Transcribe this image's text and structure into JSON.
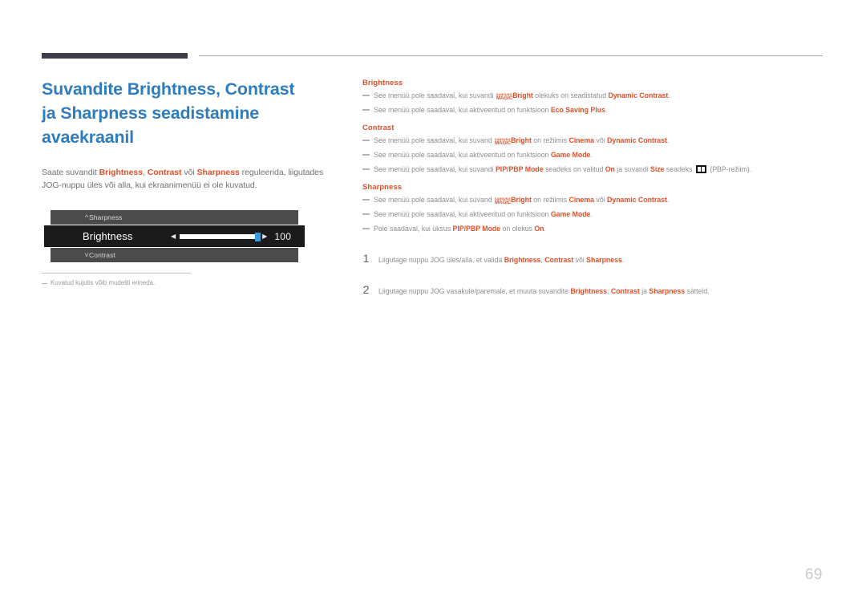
{
  "page": {
    "number": "69"
  },
  "left": {
    "title_lines": [
      "Suvandite Brightness, Contrast",
      "ja Sharpness seadistamine",
      "avaekraanil"
    ],
    "intro": {
      "p1": "Saate suvandit ",
      "b1": "Brightness",
      "p2": ", ",
      "b2": "Contrast",
      "p3": " või ",
      "b3": "Sharpness",
      "p4": " reguleerida, liigutades JOG-nuppu üles või alla, kui ekraanimenüü ei ole kuvatud."
    },
    "osd": {
      "row_top_label": "Sharpness",
      "row_top_icon": "chevron-up-icon",
      "selected_label": "Brightness",
      "selected_value": "100",
      "left_arrow": "◀",
      "right_arrow": "▶",
      "row_bottom_label": "Contrast",
      "row_bottom_icon": "chevron-down-icon"
    },
    "footnote": "Kuvatud kujutis võib mudeliti erineda."
  },
  "right": {
    "groups": [
      {
        "heading": "Brightness",
        "bullets": [
          {
            "parts": [
              {
                "t": "See menüü pole saadaval, kui suvandi ",
                "b": false
              },
              {
                "t": "SAMSUNG_MAGIC_LOGO",
                "b": false,
                "logo": true
              },
              {
                "t": "Bright",
                "b": true
              },
              {
                "t": " olekuks on seadistatud ",
                "b": false
              },
              {
                "t": "Dynamic Contrast",
                "b": true
              },
              {
                "t": ".",
                "b": false
              }
            ]
          },
          {
            "parts": [
              {
                "t": "See menüü pole saadaval, kui aktiveeritud on funktsioon ",
                "b": false
              },
              {
                "t": "Eco Saving Plus",
                "b": true
              },
              {
                "t": ".",
                "b": false
              }
            ]
          }
        ]
      },
      {
        "heading": "Contrast",
        "bullets": [
          {
            "parts": [
              {
                "t": "See menüü pole saadaval, kui suvand ",
                "b": false
              },
              {
                "t": "SAMSUNG_MAGIC_LOGO",
                "b": false,
                "logo": true
              },
              {
                "t": "Bright",
                "b": true
              },
              {
                "t": " on režiimis ",
                "b": false
              },
              {
                "t": "Cinema",
                "b": true
              },
              {
                "t": " või ",
                "b": false
              },
              {
                "t": "Dynamic Contrast",
                "b": true
              },
              {
                "t": ".",
                "b": false
              }
            ]
          },
          {
            "parts": [
              {
                "t": "See menüü pole saadaval, kui aktiveeritud on funktsioon ",
                "b": false
              },
              {
                "t": "Game Mode",
                "b": true
              },
              {
                "t": ".",
                "b": false
              }
            ]
          },
          {
            "parts": [
              {
                "t": "See menüü pole saadaval, kui suvandi ",
                "b": false
              },
              {
                "t": "PIP/PBP Mode",
                "b": true
              },
              {
                "t": " seadeks on valitud ",
                "b": false
              },
              {
                "t": "On",
                "b": true
              },
              {
                "t": " ja suvandi ",
                "b": false
              },
              {
                "t": "Size",
                "b": true
              },
              {
                "t": " seadeks ",
                "b": false
              },
              {
                "t": "PBP_ICON",
                "b": false,
                "icon": true
              },
              {
                "t": " (PBP-režiim).",
                "b": false
              }
            ]
          }
        ]
      },
      {
        "heading": "Sharpness",
        "bullets": [
          {
            "parts": [
              {
                "t": "See menüü pole saadaval, kui suvand ",
                "b": false
              },
              {
                "t": "SAMSUNG_MAGIC_LOGO",
                "b": false,
                "logo": true
              },
              {
                "t": "Bright",
                "b": true
              },
              {
                "t": " on režiimis ",
                "b": false
              },
              {
                "t": "Cinema",
                "b": true
              },
              {
                "t": " või ",
                "b": false
              },
              {
                "t": "Dynamic Contrast",
                "b": true
              },
              {
                "t": ".",
                "b": false
              }
            ]
          },
          {
            "parts": [
              {
                "t": "See menüü pole saadaval, kui aktiveeritud on funktsioon ",
                "b": false
              },
              {
                "t": "Game Mode",
                "b": true
              },
              {
                "t": ".",
                "b": false
              }
            ]
          },
          {
            "parts": [
              {
                "t": "Pole saadaval, kui üksus ",
                "b": false
              },
              {
                "t": "PIP/PBP Mode",
                "b": true
              },
              {
                "t": " on olekus ",
                "b": false
              },
              {
                "t": "On",
                "b": true
              },
              {
                "t": ".",
                "b": false
              }
            ]
          }
        ]
      }
    ],
    "steps": [
      {
        "num": "1",
        "parts": [
          {
            "t": "Liigutage nuppu JOG üles/alla, et valida ",
            "b": false
          },
          {
            "t": "Brightness",
            "b": true
          },
          {
            "t": ", ",
            "b": false
          },
          {
            "t": "Contrast",
            "b": true
          },
          {
            "t": " või ",
            "b": false
          },
          {
            "t": "Sharpness",
            "b": true
          },
          {
            "t": ".",
            "b": false
          }
        ]
      },
      {
        "num": "2",
        "parts": [
          {
            "t": "Liigutage nuppu JOG vasakule/paremale, et muuta suvandite ",
            "b": false
          },
          {
            "t": "Brightness",
            "b": true
          },
          {
            "t": ", ",
            "b": false
          },
          {
            "t": "Contrast",
            "b": true
          },
          {
            "t": " ja ",
            "b": false
          },
          {
            "t": "Sharpness",
            "b": true
          },
          {
            "t": " sätteid.",
            "b": false
          }
        ]
      }
    ]
  },
  "colors": {
    "heading_blue": "#2f7cbe",
    "accent_orange": "#e1502a",
    "body_gray": "#8f8f8f",
    "rule_dark": "#403c4a",
    "osd_row": "#4b4b4b",
    "osd_selected": "#1b1b1b",
    "slider_knob": "#3a9ada",
    "page_number": "#c9c9ce"
  },
  "logo_text": {
    "top": "SAMSUNG",
    "bottom": "MAGIC"
  }
}
